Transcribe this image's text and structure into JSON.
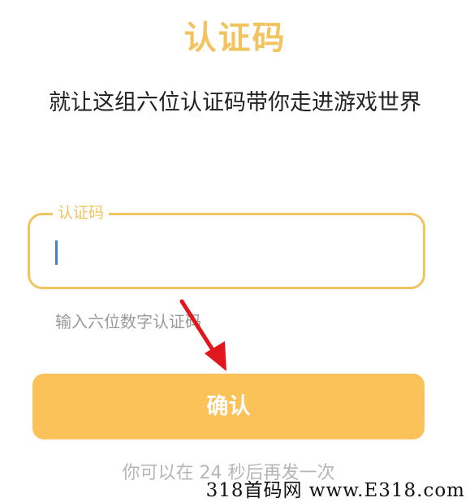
{
  "header": {
    "title": "认证码",
    "subtitle": "就让这组六位认证码带你走进游戏世界"
  },
  "form": {
    "field_label": "认证码",
    "input_value": "",
    "hint": "输入六位数字认证码"
  },
  "actions": {
    "confirm_label": "确认",
    "resend_text": "你可以在 24 秒后再发一次"
  },
  "watermark": {
    "text": "318首码网 www.E318.com"
  },
  "colors": {
    "accent": "#f2c460",
    "button": "#fbc25a",
    "arrow": "#e0171d",
    "caret": "#4a7fc2"
  }
}
